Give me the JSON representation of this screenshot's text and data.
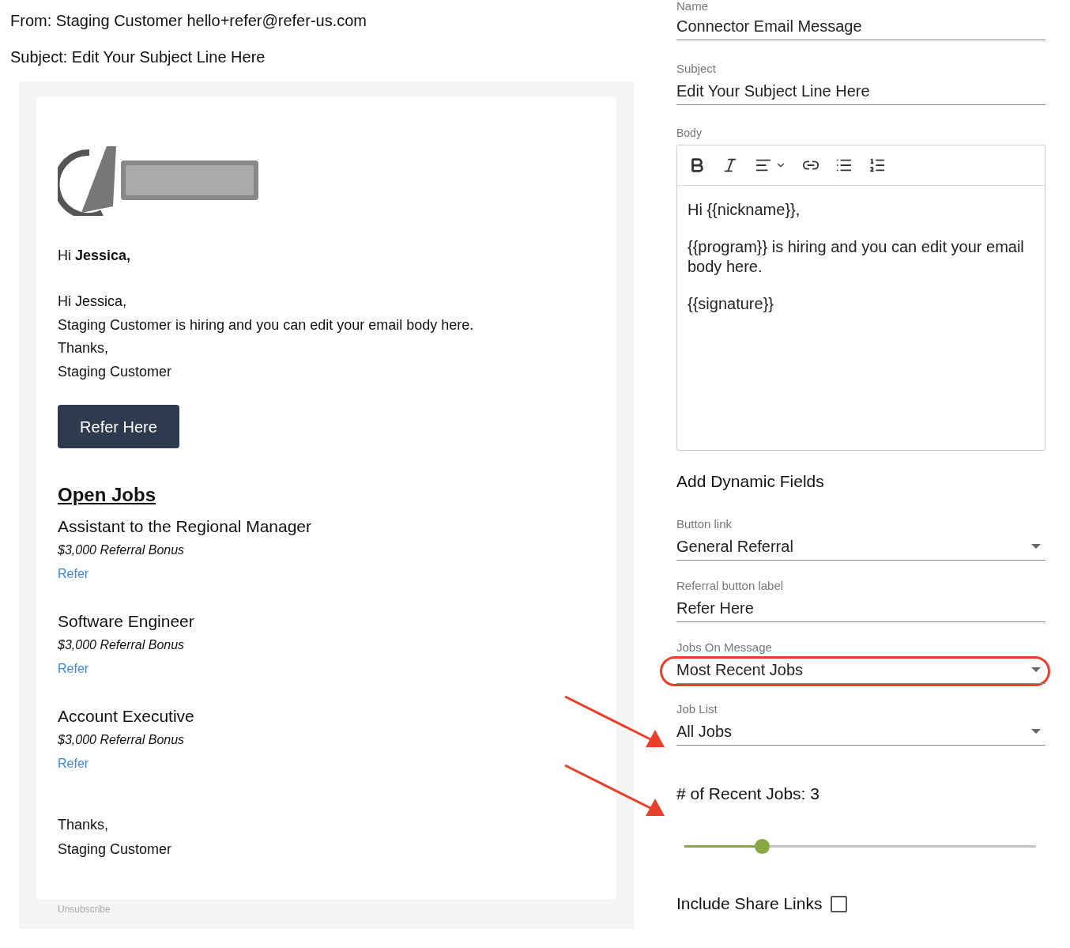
{
  "email_preview": {
    "from": "From: Staging Customer hello+refer@refer-us.com",
    "subject": "Subject: Edit Your Subject Line Here",
    "greeting": "Hi **Jessica,**",
    "body_lines": [
      "Hi Jessica,",
      "Staging Customer is hiring and you can edit your email body here.",
      "Thanks,",
      "Staging Customer"
    ],
    "button": "Refer Here",
    "jobs_heading": "Open Jobs",
    "jobs": [
      {
        "title": "Assistant to the Regional Manager",
        "bonus": "$3,000 Referral Bonus",
        "link": "Refer"
      },
      {
        "title": "Software Engineer",
        "bonus": "$3,000 Referral Bonus",
        "link": "Refer"
      },
      {
        "title": "Account Executive",
        "bonus": "$3,000 Referral Bonus",
        "link": "Refer"
      }
    ],
    "closing": [
      "Thanks,",
      "Staging Customer"
    ],
    "unsubscribe": "Unsubscribe"
  },
  "form": {
    "name": {
      "label": "Name",
      "value": "Connector Email Message"
    },
    "subject": {
      "label": "Subject",
      "value": "Edit Your Subject Line Here"
    },
    "body": {
      "label": "Body",
      "paragraphs": [
        "Hi {{nickname}},",
        "{{program}} is hiring and you can edit your email body here.",
        "{{signature}}"
      ]
    },
    "dynamic_heading": "Add Dynamic Fields",
    "fields": [
      {
        "kind": "select",
        "label": "Button link",
        "value": "General Referral",
        "circled": false
      },
      {
        "kind": "text",
        "label": "Referral button label",
        "value": "Refer Here",
        "circled": false
      },
      {
        "kind": "select",
        "label": "Jobs On Message",
        "value": "Most Recent Jobs",
        "circled": true
      },
      {
        "kind": "select",
        "label": "Job List",
        "value": "All Jobs",
        "circled": false
      }
    ],
    "recent_jobs": {
      "label": "# of Recent Jobs: 3",
      "level": 0.22
    },
    "share_links": {
      "label": "Include Share Links",
      "checked": false
    }
  }
}
